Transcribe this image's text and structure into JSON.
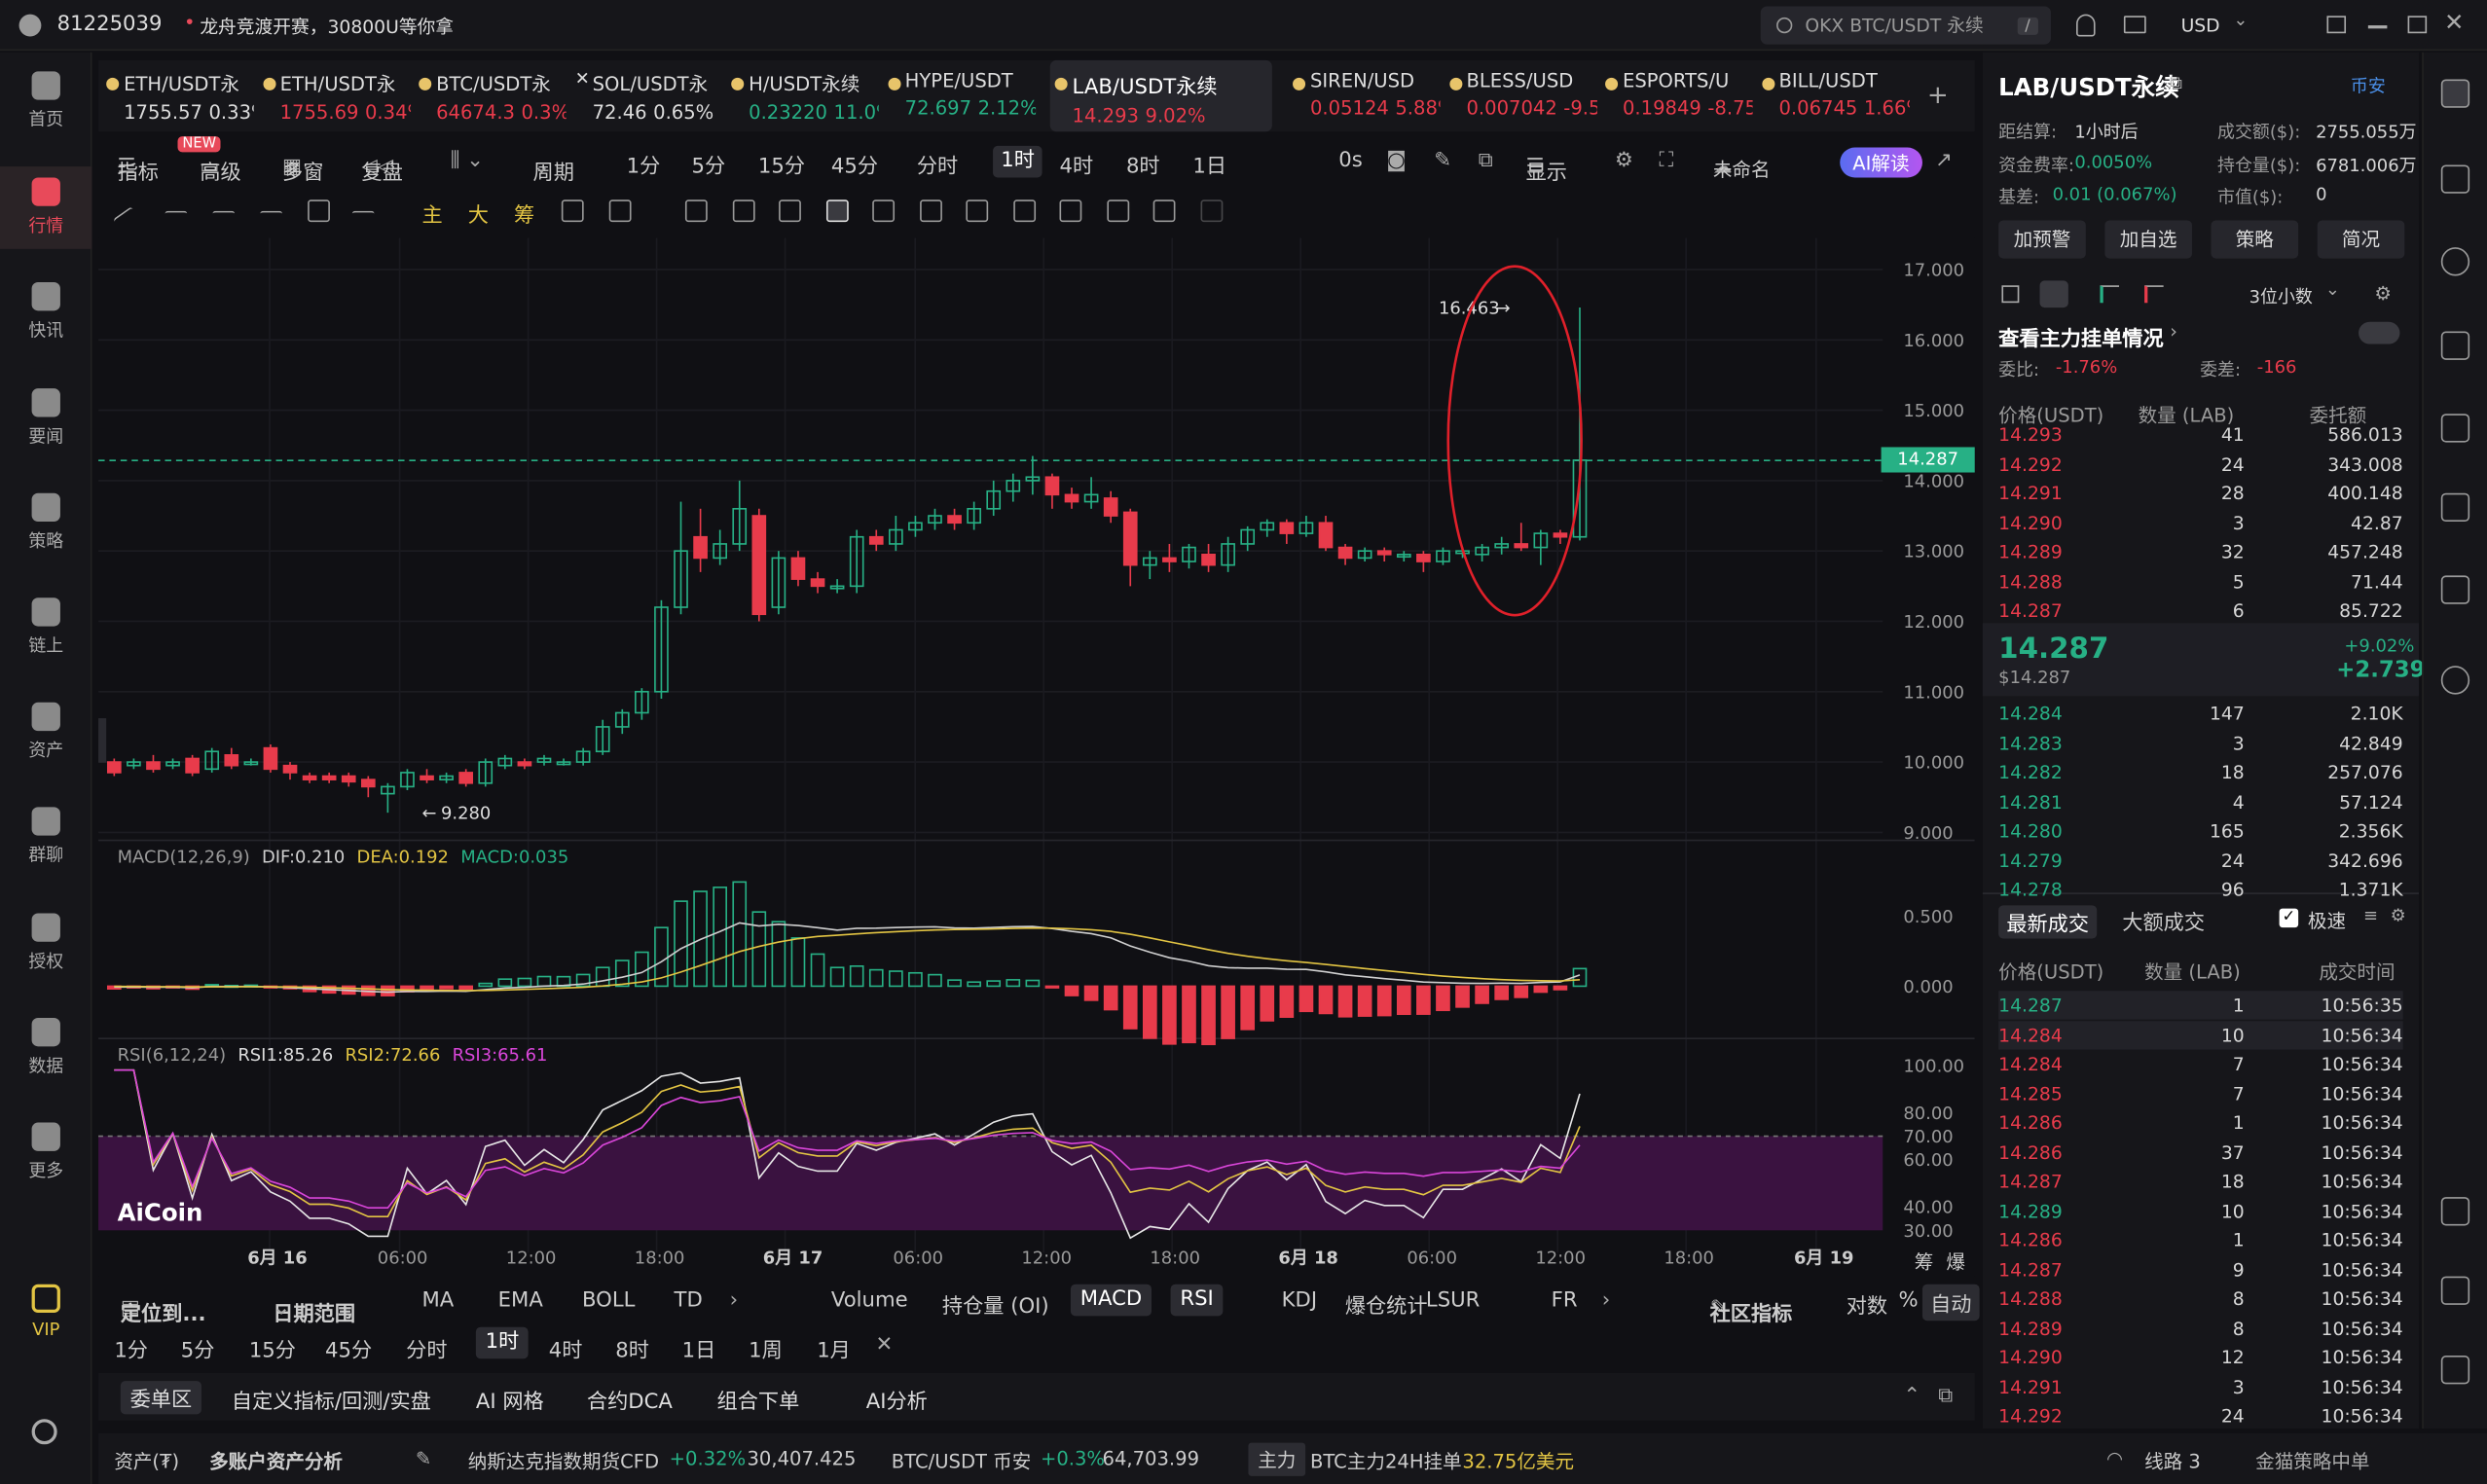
{
  "top": {
    "user_id": "81225039",
    "promo": "龙舟竞渡开赛，30800U等你拿",
    "search_placeholder": "OKX BTC/USDT 永续",
    "search_key": "/",
    "currency": "USD"
  },
  "nav": [
    {
      "label": "首页"
    },
    {
      "label": "行情"
    },
    {
      "label": "快讯"
    },
    {
      "label": "要闻"
    },
    {
      "label": "策略"
    },
    {
      "label": "链上"
    },
    {
      "label": "资产"
    },
    {
      "label": "群聊"
    },
    {
      "label": "授权"
    },
    {
      "label": "数据"
    },
    {
      "label": "更多"
    },
    {
      "label": "VIP"
    }
  ],
  "tabs": [
    {
      "name": "ETH/USDT永",
      "price": "1755.57",
      "chg": "0.33%",
      "dir": "up"
    },
    {
      "name": "ETH/USDT永",
      "price": "1755.69",
      "chg": "0.34%",
      "dir": "down"
    },
    {
      "name": "BTC/USDT永",
      "price": "64674.3",
      "chg": "0.3%",
      "dir": "down"
    },
    {
      "name": "SOL/USDT永",
      "price": "72.46",
      "chg": "0.65%",
      "dir": "flat"
    },
    {
      "name": "H/USDT永续",
      "price": "0.23220",
      "chg": "11.0%",
      "dir": "up"
    },
    {
      "name": "HYPE/USDT",
      "price": "72.697",
      "chg": "2.12%",
      "dir": "up"
    },
    {
      "name": "LAB/USDT永续",
      "price": "14.293",
      "chg": "9.02%",
      "dir": "down"
    },
    {
      "name": "SIREN/USD",
      "price": "0.05124",
      "chg": "5.88%",
      "dir": "down"
    },
    {
      "name": "BLESS/USD",
      "price": "0.007042",
      "chg": "-9.5",
      "dir": "down"
    },
    {
      "name": "ESPORTS/U",
      "price": "0.19849",
      "chg": "-8.75",
      "dir": "down"
    },
    {
      "name": "BILL/USDT",
      "price": "0.06745",
      "chg": "1.66%",
      "dir": "down"
    }
  ],
  "toolbar": {
    "indicators": "指标",
    "new_badge": "NEW",
    "advanced": "高级",
    "multi": "多窗",
    "replay": "复盘",
    "period": "周期",
    "intervals": [
      "1分",
      "5分",
      "15分",
      "45分",
      "分时",
      "1时",
      "4时",
      "8时",
      "1日"
    ],
    "active_interval": "1时",
    "seconds": "0s",
    "display": "显示",
    "unnamed": "未命名",
    "ai_btn": "AI解读"
  },
  "drawtools": {
    "main": "主",
    "big": "大",
    "chips": "筹"
  },
  "chart": {
    "price_axis": [
      "17.000",
      "16.000",
      "15.000",
      "14.000",
      "13.000",
      "12.000",
      "11.000",
      "10.000",
      "9.000"
    ],
    "current_price": "14.287",
    "high_label": "16.463",
    "low_label": "9.280",
    "time_axis": [
      "6月 16",
      "06:00",
      "12:00",
      "18:00",
      "6月 17",
      "06:00",
      "12:00",
      "18:00",
      "6月 18",
      "06:00",
      "12:00",
      "18:00",
      "6月 19"
    ],
    "corner_labels": [
      "筹",
      "爆"
    ]
  },
  "macd": {
    "title": "MACD(12,26,9)",
    "dif": "DIF:0.210",
    "dea": "DEA:0.192",
    "macd": "MACD:0.035",
    "axis": [
      "0.500",
      "0.000"
    ]
  },
  "rsi": {
    "title": "RSI(6,12,24)",
    "r1": "RSI1:85.26",
    "r2": "RSI2:72.66",
    "r3": "RSI3:65.61",
    "axis": [
      "100.00",
      "80.00",
      "70.00",
      "60.00",
      "40.00",
      "30.00"
    ],
    "watermark": "AiCoin"
  },
  "bottom_bar": {
    "locate": "定位到...",
    "date_range": "日期范围",
    "indicators": [
      "MA",
      "EMA",
      "BOLL",
      "TD"
    ],
    "sub": [
      "Volume",
      "持仓量 (OI)",
      "MACD",
      "RSI",
      "KDJ",
      "爆仓统计",
      "LSUR",
      "FR"
    ],
    "community": "社区指标",
    "log": "对数",
    "pct": "%",
    "auto": "自动"
  },
  "bottom_intervals": [
    "1分",
    "5分",
    "15分",
    "45分",
    "分时",
    "1时",
    "4时",
    "8时",
    "1日",
    "1周",
    "1月"
  ],
  "bottom_tabs": [
    "委单区",
    "自定义指标/回测/实盘",
    "AI 网格",
    "合约DCA",
    "组合下单",
    "AI分析"
  ],
  "status": {
    "assets": "资产(₮)",
    "multi": "多账户资产分析",
    "nasdaq": "纳斯达克指数期货CFD",
    "nasdaq_chg": "+0.32%",
    "nasdaq_val": "30,407.425",
    "btc": "BTC/USDT 币安",
    "btc_chg": "+0.3%",
    "btc_val": "64,703.99",
    "main": "主力",
    "btc_main": "BTC主力24H挂单",
    "btc_main_val": "32.75亿美元",
    "line": "线路 3",
    "ticker": "金猫策略中单"
  },
  "right": {
    "symbol": "LAB/USDT永续",
    "exchange": "币安",
    "settle_label": "距结算:",
    "settle_val": "1小时后",
    "turnover_label": "成交额($):",
    "turnover_val": "2755.055万",
    "funding_label": "资金费率:",
    "funding_val": "0.0050%",
    "oi_label": "持仓量($):",
    "oi_val": "6781.006万",
    "basis_label": "基差:",
    "basis_val": "0.01 (0.067%)",
    "mcap_label": "市值($):",
    "mcap_val": "0",
    "buttons": [
      "加预警",
      "加自选",
      "策略",
      "简况"
    ],
    "decimals": "3位小数",
    "main_orders": "查看主力挂单情况",
    "ratio_label": "委比:",
    "ratio_val": "-1.76%",
    "diff_label": "委差:",
    "diff_val": "-166",
    "col_price": "价格(USDT)",
    "col_qty": "数量 (LAB)",
    "col_amt": "委托额",
    "asks": [
      [
        "14.293",
        "41",
        "586.013"
      ],
      [
        "14.292",
        "24",
        "343.008"
      ],
      [
        "14.291",
        "28",
        "400.148"
      ],
      [
        "14.290",
        "3",
        "42.87"
      ],
      [
        "14.289",
        "32",
        "457.248"
      ],
      [
        "14.288",
        "5",
        "71.44"
      ],
      [
        "14.287",
        "6",
        "85.722"
      ]
    ],
    "last_price": "14.287",
    "last_usd": "$14.287",
    "last_pct": "+9.02%",
    "last_chg": "+2.739",
    "bids": [
      [
        "14.284",
        "147",
        "2.10K"
      ],
      [
        "14.283",
        "3",
        "42.849"
      ],
      [
        "14.282",
        "18",
        "257.076"
      ],
      [
        "14.281",
        "4",
        "57.124"
      ],
      [
        "14.280",
        "165",
        "2.356K"
      ],
      [
        "14.279",
        "24",
        "342.696"
      ],
      [
        "14.278",
        "96",
        "1.371K"
      ]
    ],
    "trade_tabs": [
      "最新成交",
      "大额成交"
    ],
    "fast": "极速",
    "col_time": "成交时间",
    "trades": [
      [
        "14.287",
        "1",
        "10:56:35",
        "up"
      ],
      [
        "14.284",
        "10",
        "10:56:34",
        "down"
      ],
      [
        "14.284",
        "7",
        "10:56:34",
        "down"
      ],
      [
        "14.285",
        "7",
        "10:56:34",
        "down"
      ],
      [
        "14.286",
        "1",
        "10:56:34",
        "down"
      ],
      [
        "14.286",
        "37",
        "10:56:34",
        "down"
      ],
      [
        "14.287",
        "18",
        "10:56:34",
        "down"
      ],
      [
        "14.289",
        "10",
        "10:56:34",
        "up"
      ],
      [
        "14.286",
        "1",
        "10:56:34",
        "down"
      ],
      [
        "14.287",
        "9",
        "10:56:34",
        "down"
      ],
      [
        "14.288",
        "8",
        "10:56:34",
        "down"
      ],
      [
        "14.289",
        "8",
        "10:56:34",
        "down"
      ],
      [
        "14.290",
        "12",
        "10:56:34",
        "down"
      ],
      [
        "14.291",
        "3",
        "10:56:34",
        "down"
      ],
      [
        "14.292",
        "24",
        "10:56:34",
        "down"
      ]
    ]
  },
  "colors": {
    "up": "#27b085",
    "down": "#e83b4b",
    "accent": "#e84a5a",
    "dif": "#cfcfcf",
    "dea": "#e2c443",
    "rsi3": "#d946d9"
  },
  "candles": [
    [
      10,
      10,
      9.85,
      10.05,
      9.8
    ],
    [
      11,
      9.95,
      10,
      10.05,
      9.9
    ],
    [
      12,
      10,
      9.9,
      10.1,
      9.85
    ],
    [
      13,
      9.95,
      10,
      10.05,
      9.9
    ],
    [
      14,
      10.05,
      9.85,
      10.1,
      9.8
    ],
    [
      15,
      9.9,
      10.15,
      10.2,
      9.85
    ],
    [
      16,
      10.1,
      9.95,
      10.2,
      9.9
    ],
    [
      17,
      10,
      10,
      10.05,
      9.95
    ],
    [
      18,
      10.2,
      9.9,
      10.25,
      9.85
    ],
    [
      19,
      9.95,
      9.85,
      10,
      9.75
    ],
    [
      20,
      9.8,
      9.75,
      9.85,
      9.7
    ],
    [
      21,
      9.8,
      9.75,
      9.85,
      9.7
    ],
    [
      22,
      9.8,
      9.72,
      9.85,
      9.65
    ],
    [
      23,
      9.75,
      9.65,
      9.8,
      9.5
    ],
    [
      24,
      9.55,
      9.65,
      9.7,
      9.28
    ],
    [
      25,
      9.65,
      9.85,
      9.9,
      9.6
    ],
    [
      26,
      9.8,
      9.75,
      9.9,
      9.7
    ],
    [
      27,
      9.75,
      9.8,
      9.85,
      9.7
    ],
    [
      28,
      9.85,
      9.7,
      9.9,
      9.65
    ],
    [
      29,
      9.7,
      10,
      10.05,
      9.65
    ],
    [
      30,
      9.95,
      10.05,
      10.1,
      9.9
    ],
    [
      31,
      10,
      9.95,
      10.05,
      9.9
    ],
    [
      32,
      10,
      10.05,
      10.1,
      9.95
    ],
    [
      33,
      10,
      10,
      10.05,
      9.95
    ],
    [
      34,
      10,
      10.15,
      10.2,
      9.95
    ],
    [
      35,
      10.15,
      10.5,
      10.6,
      10.1
    ],
    [
      36,
      10.5,
      10.7,
      10.75,
      10.4
    ],
    [
      37,
      10.7,
      11,
      11.05,
      10.6
    ],
    [
      38,
      11,
      12.2,
      12.3,
      10.9
    ],
    [
      39,
      12.2,
      13,
      13.7,
      12.1
    ],
    [
      40,
      13.2,
      12.9,
      13.6,
      12.7
    ],
    [
      41,
      12.9,
      13.1,
      13.3,
      12.8
    ],
    [
      42,
      13.1,
      13.6,
      14,
      13
    ],
    [
      43,
      13.5,
      12.1,
      13.6,
      12
    ],
    [
      44,
      12.2,
      12.9,
      13,
      12.1
    ],
    [
      45,
      12.9,
      12.6,
      13,
      12.5
    ],
    [
      46,
      12.6,
      12.5,
      12.7,
      12.4
    ],
    [
      47,
      12.5,
      12.5,
      12.6,
      12.4
    ],
    [
      48,
      12.5,
      13.2,
      13.3,
      12.4
    ],
    [
      49,
      13.2,
      13.1,
      13.3,
      13
    ],
    [
      50,
      13.1,
      13.3,
      13.5,
      13
    ],
    [
      51,
      13.3,
      13.4,
      13.5,
      13.2
    ],
    [
      52,
      13.4,
      13.5,
      13.6,
      13.3
    ],
    [
      53,
      13.5,
      13.4,
      13.6,
      13.3
    ],
    [
      54,
      13.4,
      13.6,
      13.7,
      13.3
    ],
    [
      55,
      13.6,
      13.85,
      14,
      13.5
    ],
    [
      56,
      13.85,
      14,
      14.1,
      13.7
    ],
    [
      57,
      14,
      14.05,
      14.35,
      13.8
    ],
    [
      58,
      14.05,
      13.8,
      14.1,
      13.6
    ],
    [
      59,
      13.8,
      13.7,
      13.9,
      13.6
    ],
    [
      60,
      13.7,
      13.8,
      14.05,
      13.6
    ],
    [
      61,
      13.75,
      13.5,
      13.85,
      13.4
    ],
    [
      62,
      13.55,
      12.8,
      13.6,
      12.5
    ],
    [
      63,
      12.8,
      12.9,
      13,
      12.6
    ],
    [
      64,
      12.9,
      12.85,
      13.1,
      12.7
    ],
    [
      65,
      12.85,
      13.05,
      13.1,
      12.75
    ],
    [
      66,
      12.95,
      12.8,
      13.1,
      12.7
    ],
    [
      67,
      12.8,
      13.1,
      13.2,
      12.7
    ],
    [
      68,
      13.1,
      13.3,
      13.35,
      13
    ],
    [
      69,
      13.3,
      13.4,
      13.45,
      13.2
    ],
    [
      70,
      13.4,
      13.25,
      13.45,
      13.1
    ],
    [
      71,
      13.25,
      13.4,
      13.5,
      13.2
    ],
    [
      72,
      13.4,
      13.05,
      13.5,
      13
    ],
    [
      73,
      13.05,
      12.9,
      13.1,
      12.8
    ],
    [
      74,
      12.9,
      13,
      13.05,
      12.85
    ],
    [
      75,
      13,
      12.95,
      13.05,
      12.85
    ],
    [
      76,
      12.95,
      12.95,
      13,
      12.85
    ],
    [
      77,
      12.95,
      12.85,
      13,
      12.7
    ],
    [
      78,
      12.85,
      13,
      13.05,
      12.8
    ],
    [
      79,
      13,
      13,
      13.05,
      12.9
    ],
    [
      80,
      12.95,
      13.05,
      13.1,
      12.85
    ],
    [
      81,
      13.05,
      13.1,
      13.2,
      12.95
    ],
    [
      82,
      13.1,
      13.05,
      13.4,
      13
    ],
    [
      83,
      13.05,
      13.25,
      13.3,
      12.8
    ],
    [
      84,
      13.25,
      13.2,
      13.3,
      13.1
    ],
    [
      85,
      13.2,
      14.29,
      16.46,
      13.15
    ]
  ]
}
